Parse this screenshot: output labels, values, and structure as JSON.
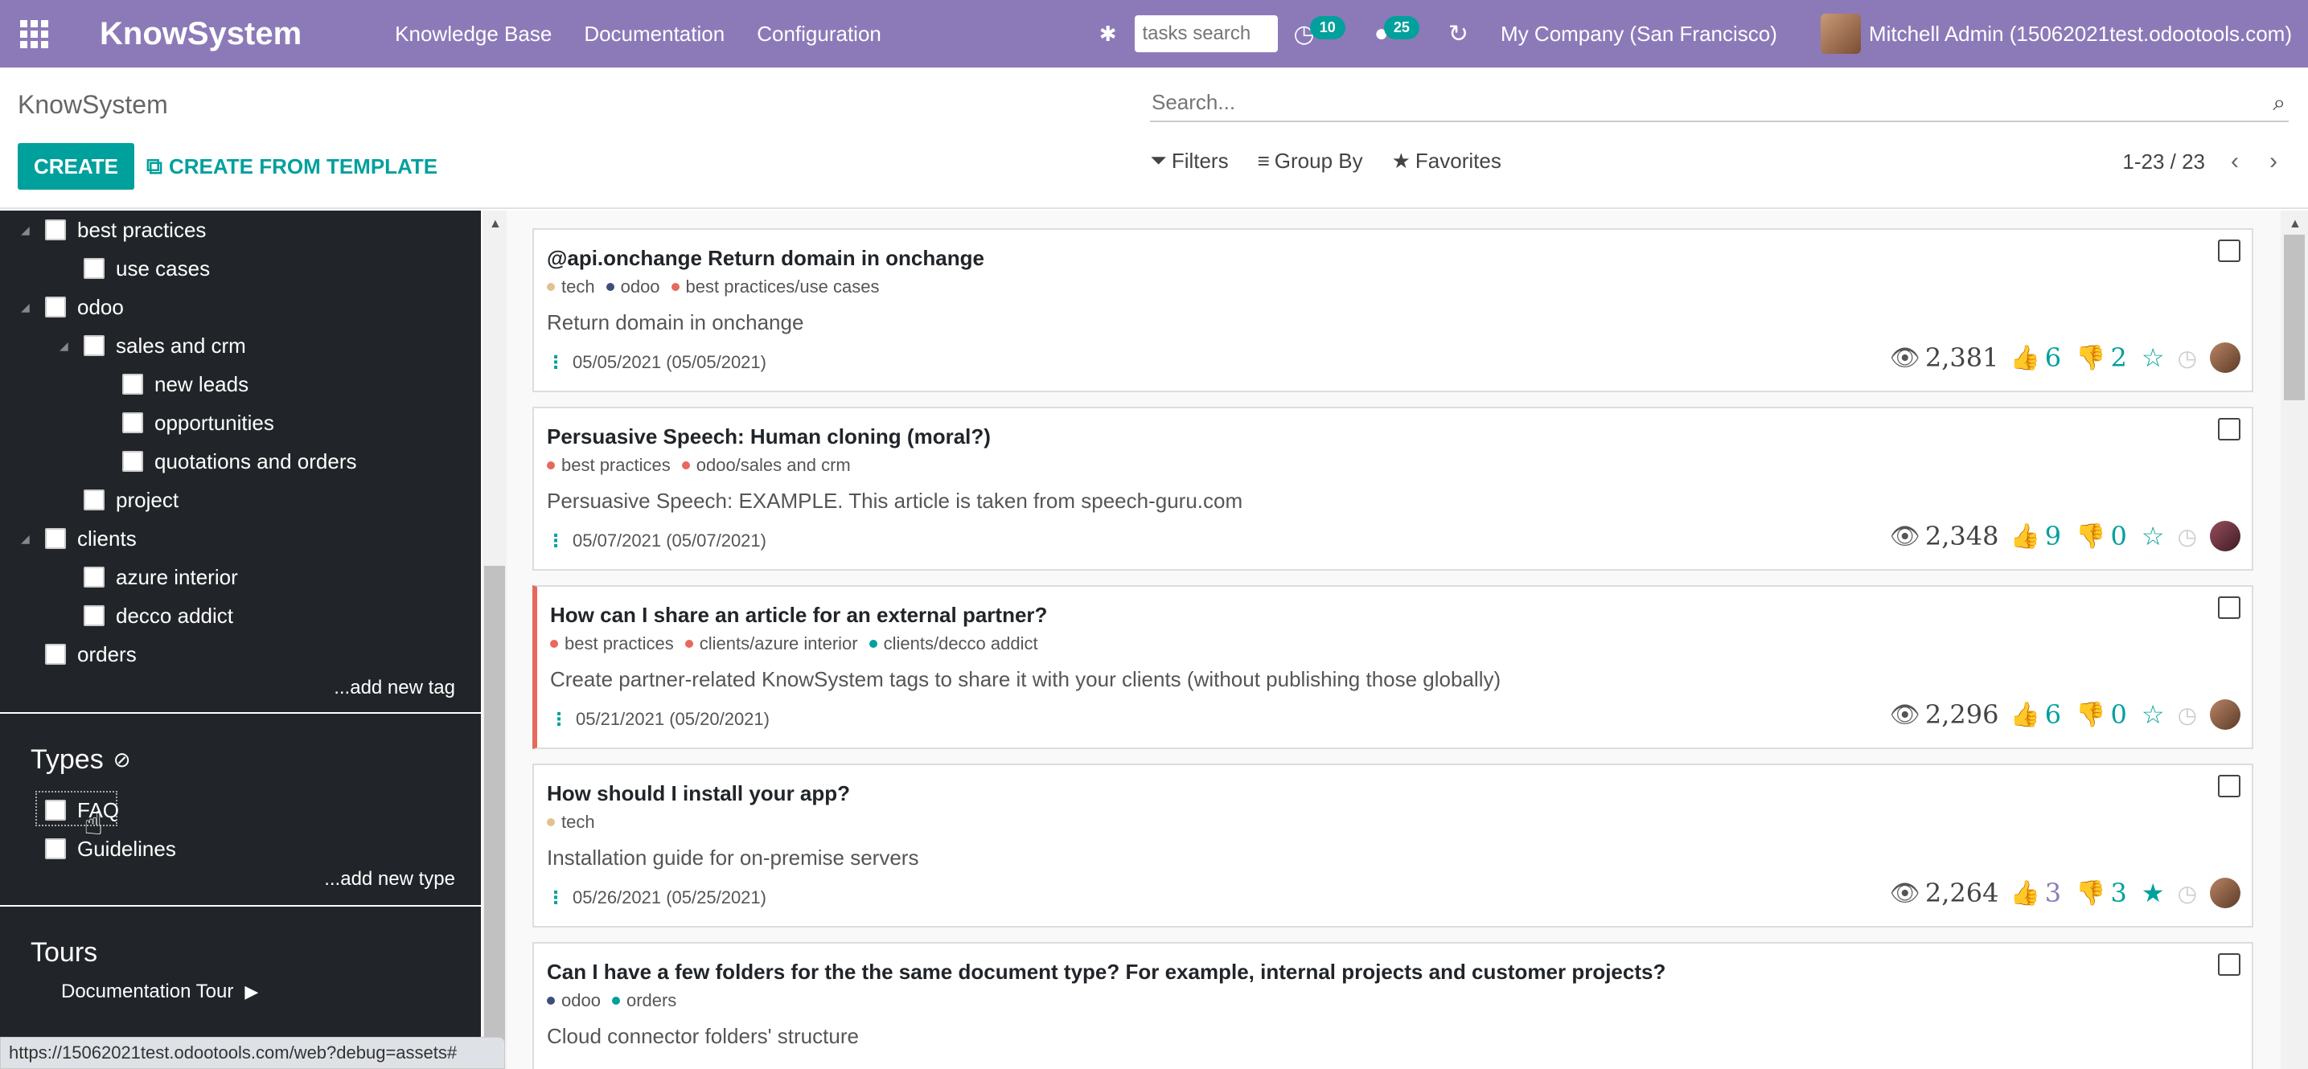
{
  "navbar": {
    "brand": "KnowSystem",
    "menu": [
      "Knowledge Base",
      "Documentation",
      "Configuration"
    ],
    "task_search_placeholder": "tasks search",
    "activities_count": "10",
    "messages_count": "25",
    "company": "My Company (San Francisco)",
    "user": "Mitchell Admin (15062021test.odootools.com)"
  },
  "control_panel": {
    "breadcrumb": "KnowSystem",
    "search_placeholder": "Search...",
    "create_label": "CREATE",
    "template_label": "CREATE FROM TEMPLATE",
    "filters_label": "Filters",
    "groupby_label": "Group By",
    "favorites_label": "Favorites",
    "pager": "1-23 / 23"
  },
  "sidebar": {
    "tags": [
      {
        "label": "best practices"
      },
      {
        "label": "use cases"
      },
      {
        "label": "odoo"
      },
      {
        "label": "sales and crm"
      },
      {
        "label": "new leads"
      },
      {
        "label": "opportunities"
      },
      {
        "label": "quotations and orders"
      },
      {
        "label": "project"
      },
      {
        "label": "clients"
      },
      {
        "label": "azure interior"
      },
      {
        "label": "decco addict"
      },
      {
        "label": "orders"
      }
    ],
    "add_tag": "...add new tag",
    "types_heading": "Types",
    "types": [
      {
        "label": "FAQ"
      },
      {
        "label": "Guidelines"
      }
    ],
    "add_type": "...add new type",
    "tours_heading": "Tours",
    "tour": "Documentation Tour"
  },
  "status_url": "https://15062021test.odootools.com/web?debug=assets#",
  "articles": [
    {
      "title": "@api.onchange Return domain in onchange",
      "tags": [
        "tech",
        "odoo",
        "best practices/use cases"
      ],
      "description": "Return domain in onchange",
      "date": "05/05/2021 (05/05/2021)",
      "views": "2,381",
      "likes": "6",
      "dislikes": "2"
    },
    {
      "title": "Persuasive Speech: Human cloning (moral?)",
      "tags": [
        "best practices",
        "odoo/sales and crm"
      ],
      "description": "Persuasive Speech: EXAMPLE. This article is taken from speech-guru.com",
      "date": "05/07/2021 (05/07/2021)",
      "views": "2,348",
      "likes": "9",
      "dislikes": "0"
    },
    {
      "title": "How can I share an article for an external partner?",
      "tags": [
        "best practices",
        "clients/azure interior",
        "clients/decco addict"
      ],
      "description": "Create partner-related KnowSystem tags to share it with your clients (without publishing those globally)",
      "date": "05/21/2021 (05/20/2021)",
      "views": "2,296",
      "likes": "6",
      "dislikes": "0"
    },
    {
      "title": "How should I install your app?",
      "tags": [
        "tech"
      ],
      "description": "Installation guide for on-premise servers",
      "date": "05/26/2021 (05/25/2021)",
      "views": "2,264",
      "likes": "3",
      "dislikes": "3"
    },
    {
      "title": "Can I have a few folders for the the same document type? For example, internal projects and customer projects?",
      "tags": [
        "odoo",
        "orders"
      ],
      "description": "Cloud connector folders' structure"
    }
  ],
  "colors": {
    "navbar": "#8c7ab8",
    "accent": "#00a09d",
    "sidebar": "#212529",
    "highlight": "#e8685b",
    "tag_tech": "#e3c18e",
    "tag_odoo": "#3d4e7a",
    "tag_best": "#e8685b",
    "tag_clients": "#00a09d"
  },
  "icons": {
    "apps": "apps-grid-icon",
    "bug": "bug-icon",
    "activity": "clock-icon",
    "messages": "comments-icon",
    "refresh": "refresh-icon",
    "search": "search-icon",
    "filter": "filter-icon",
    "groupby": "bars-icon",
    "favorites": "star-icon",
    "views": "eye-icon",
    "likes": "thumbs-up-icon",
    "dislikes": "thumbs-down-icon",
    "favorite_toggle": "star-outline-icon",
    "read_later": "clock-icon"
  }
}
